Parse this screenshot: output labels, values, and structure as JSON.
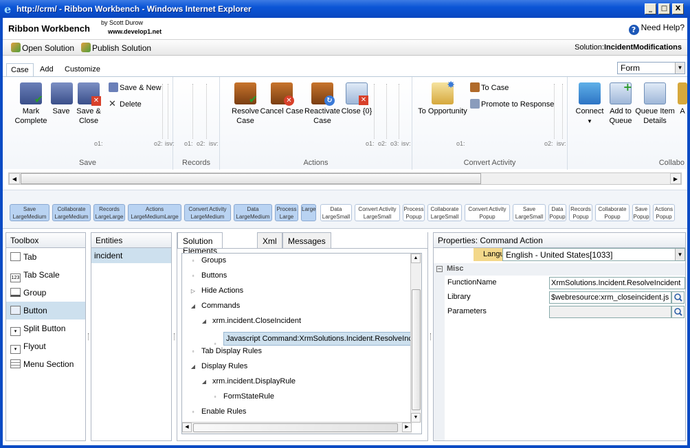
{
  "window": {
    "title": "http://crm/ - Ribbon Workbench - Windows Internet Explorer",
    "buttons": [
      "_",
      "□",
      "X"
    ]
  },
  "app": {
    "name": "Ribbon Workbench",
    "author": "by Scott Durow",
    "site": "www.develop1.net",
    "help": "Need Help?"
  },
  "toolbar": {
    "open": "Open Solution",
    "publish": "Publish Solution",
    "solution_label": "Solution:",
    "solution_name": "IncidentModifications"
  },
  "ribbon": {
    "tabs": [
      "Case",
      "Add",
      "Customize"
    ],
    "entity_form": "Form",
    "groups": {
      "save": {
        "label": "Save",
        "mark_complete": "Mark Complete",
        "save": "Save",
        "save_close": "Save & Close",
        "save_new": "Save & New",
        "delete": "Delete",
        "o1": "o1:",
        "o2": "o2:",
        "isv": "isv:"
      },
      "records": {
        "label": "Records",
        "o1": "o1:",
        "o2": "o2:",
        "isv": "isv:"
      },
      "actions": {
        "label": "Actions",
        "resolve": "Resolve Case",
        "cancel": "Cancel Case",
        "reactivate": "Reactivate Case",
        "close": "Close {0}",
        "o1": "o1:",
        "o2": "o2:",
        "o3": "o3:",
        "isv": "isv:"
      },
      "convert": {
        "label": "Convert Activity",
        "to_opp": "To Opportunity",
        "to_case": "To Case",
        "promote": "Promote to Response",
        "o1": "o1:",
        "o2": "o2:",
        "isv": "isv:"
      },
      "collab": {
        "label": "Collabo",
        "connect": "Connect",
        "add_queue": "Add to Queue",
        "queue_details": "Queue Item Details",
        "assign": "A"
      }
    }
  },
  "templates": [
    {
      "top": "Save",
      "bottom": "LargeMedium",
      "on": true
    },
    {
      "top": "Collaborate",
      "bottom": "LargeMedium",
      "on": true
    },
    {
      "top": "Records",
      "bottom": "LargeLarge",
      "on": true
    },
    {
      "top": "Actions",
      "bottom": "LargeMediumLarge",
      "on": true
    },
    {
      "top": "Convert Activity",
      "bottom": "LargeMedium",
      "on": true
    },
    {
      "top": "Data",
      "bottom": "LargeMedium",
      "on": true
    },
    {
      "top": "Process",
      "bottom": "Large",
      "on": true
    },
    {
      "top": "Large",
      "bottom": "",
      "on": true
    },
    {
      "top": "Data",
      "bottom": "LargeSmall",
      "on": false
    },
    {
      "top": "Convert Activity",
      "bottom": "LargeSmall",
      "on": false
    },
    {
      "top": "Process",
      "bottom": "Popup",
      "on": false
    },
    {
      "top": "Collaborate",
      "bottom": "LargeSmall",
      "on": false
    },
    {
      "top": "Convert Activity",
      "bottom": "Popup",
      "on": false
    },
    {
      "top": "Save",
      "bottom": "LargeSmall",
      "on": false
    },
    {
      "top": "Data",
      "bottom": "Popup",
      "on": false
    },
    {
      "top": "Records",
      "bottom": "Popup",
      "on": false
    },
    {
      "top": "Collaborate",
      "bottom": "Popup",
      "on": false
    },
    {
      "top": "Save",
      "bottom": "Popup",
      "on": false
    },
    {
      "top": "Actions",
      "bottom": "Popup",
      "on": false
    }
  ],
  "toolbox": {
    "title": "Toolbox",
    "items": [
      "Tab",
      "Tab Scale",
      "Group",
      "Button",
      "Split Button",
      "Flyout",
      "Menu Section"
    ]
  },
  "entities": {
    "title": "Entities",
    "items": [
      "incident"
    ]
  },
  "solution": {
    "tabs": [
      "Solution Elements",
      "Xml",
      "Messages"
    ],
    "tree": [
      {
        "label": "Groups",
        "bullet": "▫",
        "level": 0
      },
      {
        "label": "Buttons",
        "bullet": "▫",
        "level": 0
      },
      {
        "label": "Hide Actions",
        "bullet": "▷",
        "level": 0
      },
      {
        "label": "Commands",
        "bullet": "◢",
        "level": 0
      },
      {
        "label": "xrm.incident.CloseIncident",
        "bullet": "◢",
        "level": 1
      },
      {
        "label": "Javascript Command:XrmSolutions.Incident.ResolveIncide",
        "bullet": "▫",
        "level": 2,
        "selected": true
      },
      {
        "label": "Tab Display Rules",
        "bullet": "▫",
        "level": 0
      },
      {
        "label": "Display Rules",
        "bullet": "◢",
        "level": 0
      },
      {
        "label": "xrm.incident.DisplayRule",
        "bullet": "◢",
        "level": 1
      },
      {
        "label": "FormStateRule",
        "bullet": "▫",
        "level": 2
      },
      {
        "label": "Enable Rules",
        "bullet": "▫",
        "level": 0
      }
    ]
  },
  "properties": {
    "title": "Properties: Command Action",
    "language_label": "Language:",
    "language_value": "English - United States[1033]",
    "section": "Misc",
    "rows": [
      {
        "key": "FunctionName",
        "value": "XrmSolutions.Incident.ResolveIncident"
      },
      {
        "key": "Library",
        "value": "$webresource:xrm_closeincident.js"
      },
      {
        "key": "Parameters",
        "value": ""
      }
    ]
  },
  "colors": {
    "titlebar": "#0b55d6",
    "selection": "#cde0ee",
    "template_on": "#b9d3f2",
    "language_bg": "#f3d88a"
  }
}
